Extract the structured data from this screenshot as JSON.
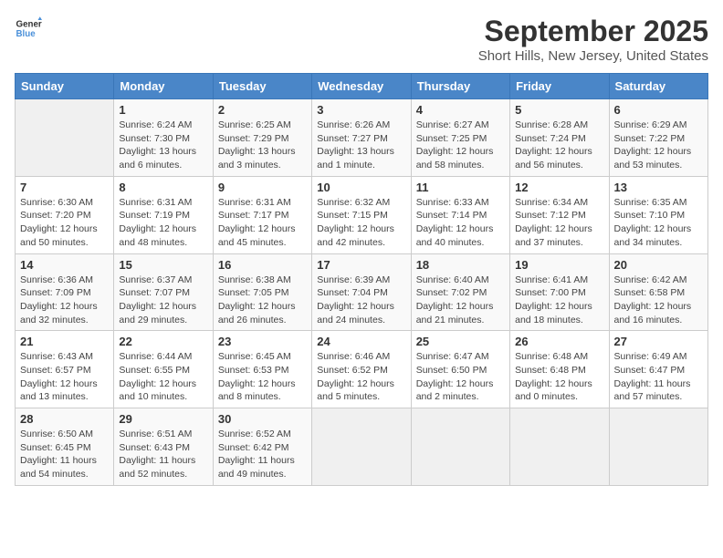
{
  "header": {
    "logo_general": "General",
    "logo_blue": "Blue",
    "month_title": "September 2025",
    "location": "Short Hills, New Jersey, United States"
  },
  "days_of_week": [
    "Sunday",
    "Monday",
    "Tuesday",
    "Wednesday",
    "Thursday",
    "Friday",
    "Saturday"
  ],
  "weeks": [
    [
      {
        "day": "",
        "info": ""
      },
      {
        "day": "1",
        "info": "Sunrise: 6:24 AM\nSunset: 7:30 PM\nDaylight: 13 hours\nand 6 minutes."
      },
      {
        "day": "2",
        "info": "Sunrise: 6:25 AM\nSunset: 7:29 PM\nDaylight: 13 hours\nand 3 minutes."
      },
      {
        "day": "3",
        "info": "Sunrise: 6:26 AM\nSunset: 7:27 PM\nDaylight: 13 hours\nand 1 minute."
      },
      {
        "day": "4",
        "info": "Sunrise: 6:27 AM\nSunset: 7:25 PM\nDaylight: 12 hours\nand 58 minutes."
      },
      {
        "day": "5",
        "info": "Sunrise: 6:28 AM\nSunset: 7:24 PM\nDaylight: 12 hours\nand 56 minutes."
      },
      {
        "day": "6",
        "info": "Sunrise: 6:29 AM\nSunset: 7:22 PM\nDaylight: 12 hours\nand 53 minutes."
      }
    ],
    [
      {
        "day": "7",
        "info": "Sunrise: 6:30 AM\nSunset: 7:20 PM\nDaylight: 12 hours\nand 50 minutes."
      },
      {
        "day": "8",
        "info": "Sunrise: 6:31 AM\nSunset: 7:19 PM\nDaylight: 12 hours\nand 48 minutes."
      },
      {
        "day": "9",
        "info": "Sunrise: 6:31 AM\nSunset: 7:17 PM\nDaylight: 12 hours\nand 45 minutes."
      },
      {
        "day": "10",
        "info": "Sunrise: 6:32 AM\nSunset: 7:15 PM\nDaylight: 12 hours\nand 42 minutes."
      },
      {
        "day": "11",
        "info": "Sunrise: 6:33 AM\nSunset: 7:14 PM\nDaylight: 12 hours\nand 40 minutes."
      },
      {
        "day": "12",
        "info": "Sunrise: 6:34 AM\nSunset: 7:12 PM\nDaylight: 12 hours\nand 37 minutes."
      },
      {
        "day": "13",
        "info": "Sunrise: 6:35 AM\nSunset: 7:10 PM\nDaylight: 12 hours\nand 34 minutes."
      }
    ],
    [
      {
        "day": "14",
        "info": "Sunrise: 6:36 AM\nSunset: 7:09 PM\nDaylight: 12 hours\nand 32 minutes."
      },
      {
        "day": "15",
        "info": "Sunrise: 6:37 AM\nSunset: 7:07 PM\nDaylight: 12 hours\nand 29 minutes."
      },
      {
        "day": "16",
        "info": "Sunrise: 6:38 AM\nSunset: 7:05 PM\nDaylight: 12 hours\nand 26 minutes."
      },
      {
        "day": "17",
        "info": "Sunrise: 6:39 AM\nSunset: 7:04 PM\nDaylight: 12 hours\nand 24 minutes."
      },
      {
        "day": "18",
        "info": "Sunrise: 6:40 AM\nSunset: 7:02 PM\nDaylight: 12 hours\nand 21 minutes."
      },
      {
        "day": "19",
        "info": "Sunrise: 6:41 AM\nSunset: 7:00 PM\nDaylight: 12 hours\nand 18 minutes."
      },
      {
        "day": "20",
        "info": "Sunrise: 6:42 AM\nSunset: 6:58 PM\nDaylight: 12 hours\nand 16 minutes."
      }
    ],
    [
      {
        "day": "21",
        "info": "Sunrise: 6:43 AM\nSunset: 6:57 PM\nDaylight: 12 hours\nand 13 minutes."
      },
      {
        "day": "22",
        "info": "Sunrise: 6:44 AM\nSunset: 6:55 PM\nDaylight: 12 hours\nand 10 minutes."
      },
      {
        "day": "23",
        "info": "Sunrise: 6:45 AM\nSunset: 6:53 PM\nDaylight: 12 hours\nand 8 minutes."
      },
      {
        "day": "24",
        "info": "Sunrise: 6:46 AM\nSunset: 6:52 PM\nDaylight: 12 hours\nand 5 minutes."
      },
      {
        "day": "25",
        "info": "Sunrise: 6:47 AM\nSunset: 6:50 PM\nDaylight: 12 hours\nand 2 minutes."
      },
      {
        "day": "26",
        "info": "Sunrise: 6:48 AM\nSunset: 6:48 PM\nDaylight: 12 hours\nand 0 minutes."
      },
      {
        "day": "27",
        "info": "Sunrise: 6:49 AM\nSunset: 6:47 PM\nDaylight: 11 hours\nand 57 minutes."
      }
    ],
    [
      {
        "day": "28",
        "info": "Sunrise: 6:50 AM\nSunset: 6:45 PM\nDaylight: 11 hours\nand 54 minutes."
      },
      {
        "day": "29",
        "info": "Sunrise: 6:51 AM\nSunset: 6:43 PM\nDaylight: 11 hours\nand 52 minutes."
      },
      {
        "day": "30",
        "info": "Sunrise: 6:52 AM\nSunset: 6:42 PM\nDaylight: 11 hours\nand 49 minutes."
      },
      {
        "day": "",
        "info": ""
      },
      {
        "day": "",
        "info": ""
      },
      {
        "day": "",
        "info": ""
      },
      {
        "day": "",
        "info": ""
      }
    ]
  ]
}
